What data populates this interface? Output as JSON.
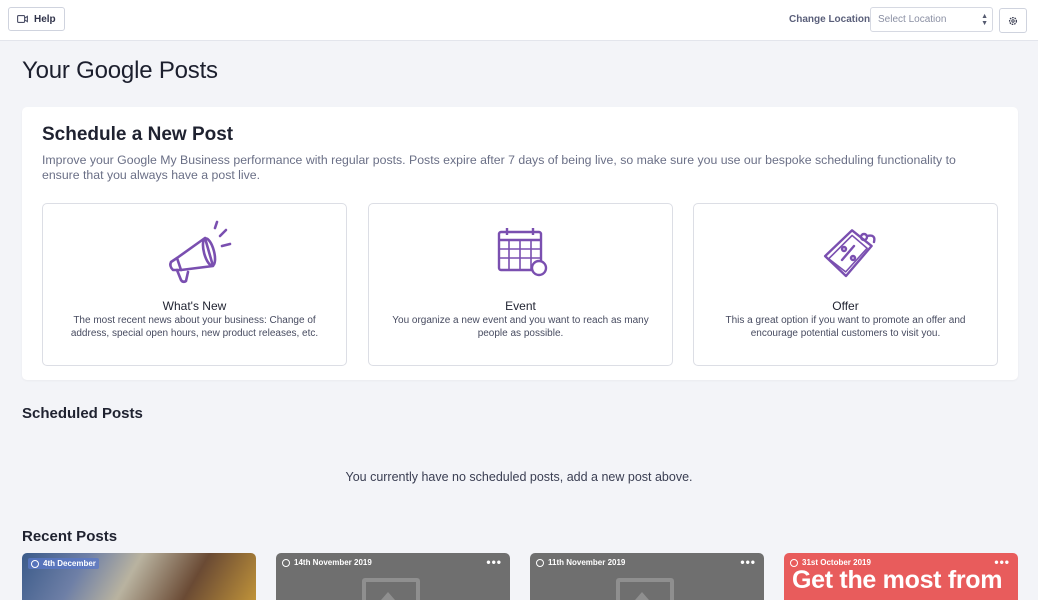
{
  "topbar": {
    "help_label": "Help",
    "change_location_label": "Change Location:",
    "location_placeholder": "Select Location"
  },
  "page_title": "Your Google Posts",
  "schedule": {
    "title": "Schedule a New Post",
    "description": "Improve your Google My Business performance with regular posts. Posts expire after 7 days of being live, so make sure you use our bespoke scheduling functionality to ensure that you always have a post live.",
    "options": [
      {
        "icon": "megaphone-icon",
        "title": "What's New",
        "description": "The most recent news about your business: Change of address, special open hours, new product releases, etc."
      },
      {
        "icon": "calendar-icon",
        "title": "Event",
        "description": "You organize a new event and you want to reach as many people as possible."
      },
      {
        "icon": "tag-icon",
        "title": "Offer",
        "description": "This a great option if you want to promote an offer and encourage potential customers to visit you."
      }
    ]
  },
  "scheduled": {
    "heading": "Scheduled Posts",
    "empty_message": "You currently have no scheduled posts, add a new post above."
  },
  "recent": {
    "heading": "Recent Posts",
    "posts": [
      {
        "date": "4th December",
        "menu": "•••"
      },
      {
        "date": "14th November 2019",
        "menu": "•••"
      },
      {
        "date": "11th November 2019",
        "menu": "•••"
      },
      {
        "date": "31st October 2019",
        "menu": "•••",
        "image_text": "Get the most from"
      }
    ]
  },
  "colors": {
    "accent_purple": "#7a4fb0",
    "offer_red": "#e85c5c"
  }
}
